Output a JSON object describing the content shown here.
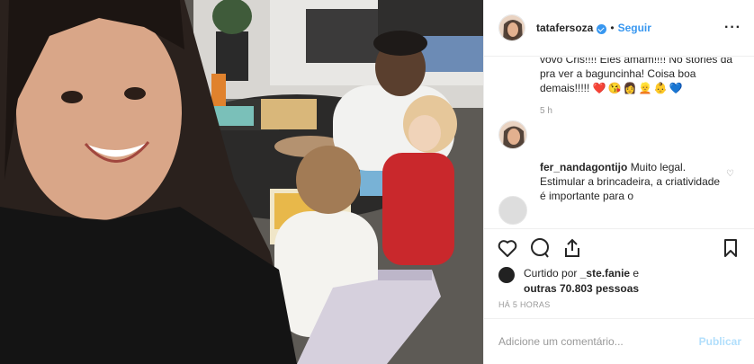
{
  "post": {
    "photo_alt_icon": "photo",
    "author": {
      "username": "tatafersoza",
      "verified": true,
      "follow_label": "Seguir",
      "separator": "•"
    },
    "more_icon": "more-horizontal-icon",
    "caption": {
      "username": "tatafersoza",
      "text": "Nossa atividade nessa manhã chuvosa! Tinta e carimbo com a vovó Cris!!!! Eles amam!!!! No stories da pra ver a baguncinha! Coisa boa demais!!!!!",
      "emojis": [
        "❤️",
        "😘",
        "👩",
        "👱",
        "👶",
        "💙"
      ],
      "time": "5 h"
    },
    "comments": [
      {
        "username": "fer_nandagontijo",
        "text": "Muito legal. Estimular a brincadeira, a criatividade é importante para o"
      }
    ],
    "likes": {
      "prefix": "Curtido por",
      "user": "_ste.fanie",
      "connector": "e",
      "others": "outras 70.803 pessoas"
    },
    "timestamp": "HÁ 5 HORAS",
    "add_comment": {
      "placeholder": "Adicione um comentário...",
      "publish_label": "Publicar"
    }
  },
  "colors": {
    "accent": "#3897f0",
    "publish_disabled": "#b2dffc",
    "muted": "#999999",
    "text": "#262626"
  }
}
